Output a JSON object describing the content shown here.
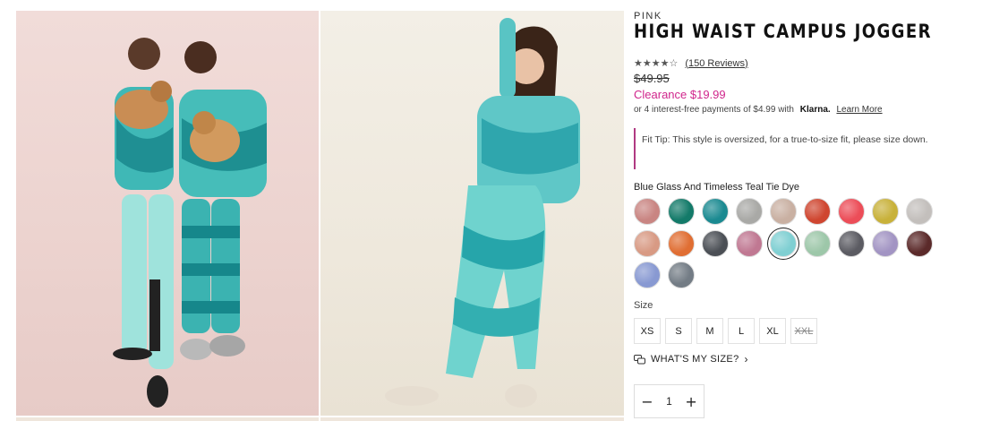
{
  "product": {
    "brand": "PINK",
    "title": "HIGH WAIST CAMPUS JOGGER",
    "rating_stars": "★★★★☆",
    "reviews": "(150 Reviews)",
    "original_price": "$49.95",
    "clearance_price": "Clearance $19.99",
    "klarna_prefix": "or 4 interest-free payments of $4.99 with",
    "klarna_logo": "Klarna.",
    "klarna_link": "Learn More",
    "fit_tip": "Fit Tip: This style is oversized, for a true-to-size fit, please size down.",
    "color_name": "Blue Glass And Timeless Teal Tie Dye"
  },
  "swatches": [
    {
      "name": "dusty-rose-tie-dye",
      "color": "#c98582"
    },
    {
      "name": "green-teal-tie-dye",
      "color": "#137a69"
    },
    {
      "name": "teal-swirl-tie-dye",
      "color": "#1b8a91"
    },
    {
      "name": "grey-heather",
      "color": "#a9a9a6"
    },
    {
      "name": "leopard",
      "color": "#c9b0a2"
    },
    {
      "name": "red-orange",
      "color": "#cf4630"
    },
    {
      "name": "coral-red",
      "color": "#ec4d58"
    },
    {
      "name": "mustard",
      "color": "#c8b13a"
    },
    {
      "name": "light-grey",
      "color": "#c3bfbc"
    },
    {
      "name": "peach-tie-dye",
      "color": "#d89a84"
    },
    {
      "name": "orange",
      "color": "#e06e33"
    },
    {
      "name": "black-grey-tie-dye",
      "color": "#4b4f55"
    },
    {
      "name": "pink-purple-tie-dye",
      "color": "#c07892"
    },
    {
      "name": "blue-glass-teal-tie-dye",
      "color": "#7fcfd2"
    },
    {
      "name": "sage-green",
      "color": "#9dc7a9"
    },
    {
      "name": "black-white-tie-dye",
      "color": "#5b5b62"
    },
    {
      "name": "lavender-tie-dye",
      "color": "#a294c3"
    },
    {
      "name": "maroon",
      "color": "#5b2a2a"
    },
    {
      "name": "periwinkle-tie-dye",
      "color": "#8899d2"
    },
    {
      "name": "grey-blue-tie-dye",
      "color": "#737c85"
    }
  ],
  "selected_swatch_index": 13,
  "size": {
    "label": "Size",
    "options": [
      {
        "label": "XS",
        "available": true
      },
      {
        "label": "S",
        "available": true
      },
      {
        "label": "M",
        "available": true
      },
      {
        "label": "L",
        "available": true
      },
      {
        "label": "XL",
        "available": true
      },
      {
        "label": "XXL",
        "available": false
      }
    ],
    "whats_my_size": "WHAT'S MY SIZE?"
  },
  "quantity": {
    "minus": "−",
    "value": "1",
    "plus": "+"
  }
}
